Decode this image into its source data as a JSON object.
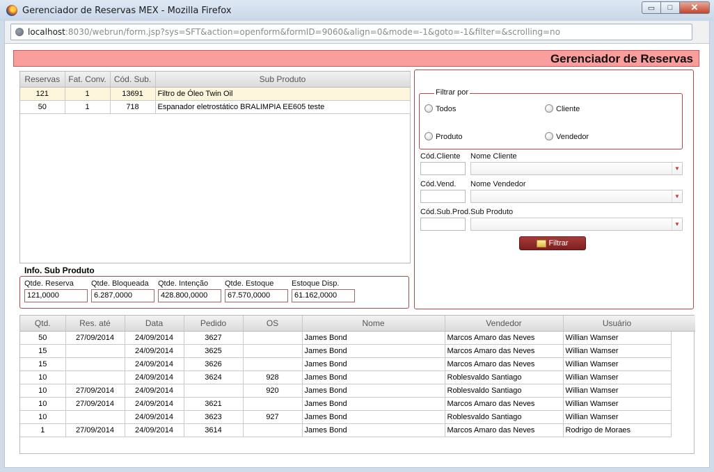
{
  "window": {
    "title": "Gerenciador de Reservas MEX - Mozilla Firefox",
    "url_host": "localhost",
    "url_rest": ":8030/webrun/form.jsp?sys=SFT&action=openform&formID=9060&align=0&mode=-1&goto=-1&filter=&scrolling=no",
    "minimize": "▭",
    "maximize": "□",
    "close": "✕"
  },
  "header": {
    "title": "Gerenciador de Reservas"
  },
  "subproducts": {
    "columns": [
      "Reservas",
      "Fat. Conv.",
      "Cód. Sub.",
      "Sub Produto"
    ],
    "rows": [
      {
        "reservas": "121",
        "fat_conv": "1",
        "cod_sub": "13691",
        "sub_produto": "Filtro de Óleo Twin Oil"
      },
      {
        "reservas": "50",
        "fat_conv": "1",
        "cod_sub": "718",
        "sub_produto": "Espanador eletrostático BRALIMPIA EE605 teste"
      }
    ]
  },
  "info": {
    "title": "Info. Sub Produto",
    "qtde_reserva_label": "Qtde. Reserva",
    "qtde_reserva": "121,0000",
    "qtde_bloqueada_label": "Qtde. Bloqueada",
    "qtde_bloqueada": "6.287,0000",
    "qtde_intencao_label": "Qtde. Intenção",
    "qtde_intencao": "428.800,0000",
    "qtde_estoque_label": "Qtde. Estoque",
    "qtde_estoque": "67.570,0000",
    "estoque_disp_label": "Estoque Disp.",
    "estoque_disp": "61.162,0000"
  },
  "filter": {
    "legend": "Filtrar por",
    "todos": "Todos",
    "cliente": "Cliente",
    "produto": "Produto",
    "vendedor": "Vendedor",
    "cod_cliente_label": "Cód.Cliente",
    "nome_cliente_label": "Nome Cliente",
    "cod_vend_label": "Cód.Vend.",
    "nome_vendedor_label": "Nome Vendedor",
    "cod_subprod_label": "Cód.Sub.Prod.",
    "sub_produto_label": "Sub Produto",
    "button": "Filtrar"
  },
  "reservations": {
    "columns": [
      "Qtd.",
      "Res. até",
      "Data",
      "Pedido",
      "OS",
      "Nome",
      "Vendedor",
      "Usuário"
    ],
    "rows": [
      {
        "qtd": "50",
        "res_ate": "27/09/2014",
        "data": "24/09/2014",
        "pedido": "3627",
        "os": "",
        "nome": "James Bond",
        "vendedor": "Marcos Amaro das Neves",
        "usuario": "Willian Wamser"
      },
      {
        "qtd": "15",
        "res_ate": "",
        "data": "24/09/2014",
        "pedido": "3625",
        "os": "",
        "nome": "James Bond",
        "vendedor": "Marcos Amaro das Neves",
        "usuario": "Willian Wamser"
      },
      {
        "qtd": "15",
        "res_ate": "",
        "data": "24/09/2014",
        "pedido": "3626",
        "os": "",
        "nome": "James Bond",
        "vendedor": "Marcos Amaro das Neves",
        "usuario": "Willian Wamser"
      },
      {
        "qtd": "10",
        "res_ate": "",
        "data": "24/09/2014",
        "pedido": "3624",
        "os": "928",
        "nome": "James Bond",
        "vendedor": "Roblesvaldo Santiago",
        "usuario": "Willian Wamser"
      },
      {
        "qtd": "10",
        "res_ate": "27/09/2014",
        "data": "24/09/2014",
        "pedido": "",
        "os": "920",
        "nome": "James Bond",
        "vendedor": "Roblesvaldo Santiago",
        "usuario": "Willian Wamser"
      },
      {
        "qtd": "10",
        "res_ate": "27/09/2014",
        "data": "24/09/2014",
        "pedido": "3621",
        "os": "",
        "nome": "James Bond",
        "vendedor": "Marcos Amaro das Neves",
        "usuario": "Willian Wamser"
      },
      {
        "qtd": "10",
        "res_ate": "",
        "data": "24/09/2014",
        "pedido": "3623",
        "os": "927",
        "nome": "James Bond",
        "vendedor": "Roblesvaldo Santiago",
        "usuario": "Willian Wamser"
      },
      {
        "qtd": "1",
        "res_ate": "27/09/2014",
        "data": "24/09/2014",
        "pedido": "3614",
        "os": "",
        "nome": "James Bond",
        "vendedor": "Marcos Amaro das Neves",
        "usuario": "Rodrigo de Moraes"
      }
    ]
  }
}
